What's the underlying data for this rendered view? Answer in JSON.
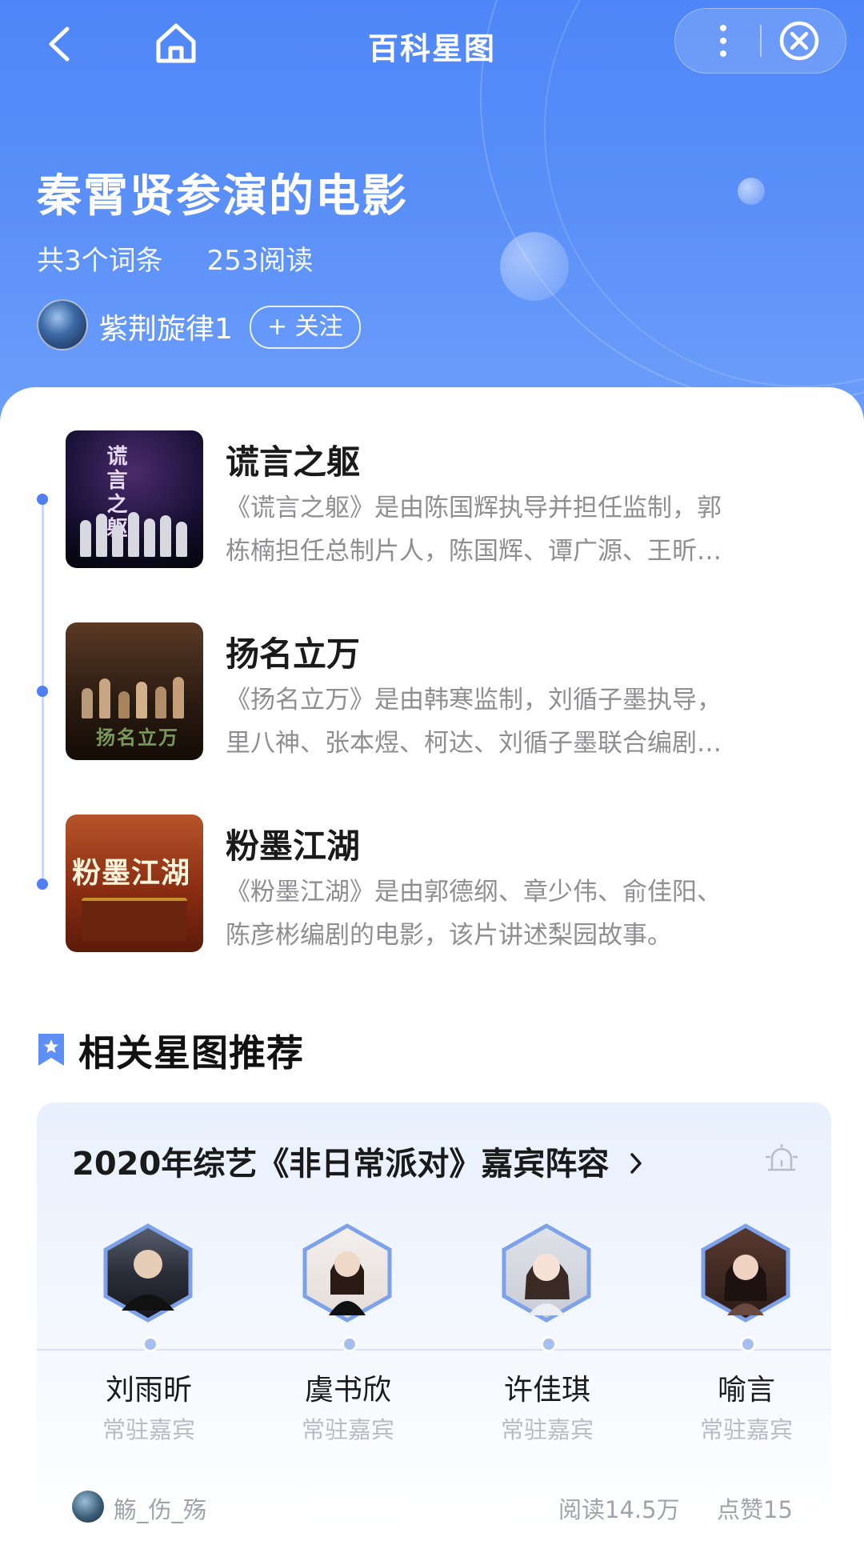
{
  "nav": {
    "title": "百科星图",
    "icons": [
      "back-icon",
      "home-icon",
      "more-icon",
      "close-icon"
    ]
  },
  "header": {
    "title": "秦霄贤参演的电影",
    "entry_count": "共3个词条",
    "read_count": "253阅读",
    "author": "紫荆旋律1",
    "follow_label": "+ 关注"
  },
  "entries": [
    {
      "title": "谎言之躯",
      "desc_line1": "《谎言之躯》是由陈国辉执导并担任监制，郭",
      "desc_line2": "栋楠担任总制片人，陈国辉、谭广源、王昕…",
      "poster_text": "谎言之躯"
    },
    {
      "title": "扬名立万",
      "desc_line1": "《扬名立万》是由韩寒监制，刘循子墨执导，",
      "desc_line2": "里八神、张本煜、柯达、刘循子墨联合编剧…",
      "poster_text": "扬名立万"
    },
    {
      "title": "粉墨江湖",
      "desc_line1": "《粉墨江湖》是由郭德纲、章少伟、俞佳阳、",
      "desc_line2": "陈彦彬编剧的电影，该片讲述梨园故事。",
      "poster_text": "粉墨江湖"
    }
  ],
  "related": {
    "section_title": "相关星图推荐",
    "card_title": "2020年综艺《非日常派对》嘉宾阵容",
    "guests": [
      {
        "name": "刘雨昕",
        "role": "常驻嘉宾"
      },
      {
        "name": "虞书欣",
        "role": "常驻嘉宾"
      },
      {
        "name": "许佳琪",
        "role": "常驻嘉宾"
      },
      {
        "name": "喻言",
        "role": "常驻嘉宾"
      }
    ],
    "footer_user": "觞_伤_殇",
    "footer_reads": "阅读14.5万",
    "footer_likes": "点赞15"
  },
  "colors": {
    "header_blue": "#4f86f7",
    "accent_blue": "#4f7ff3",
    "muted_text": "#8e8e93"
  }
}
